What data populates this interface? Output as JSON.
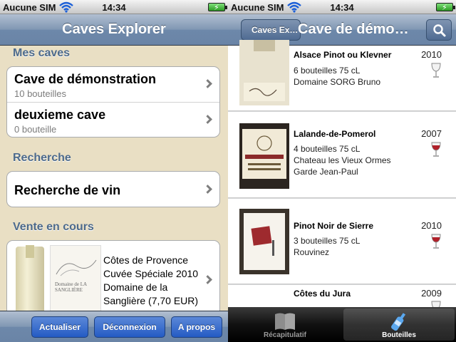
{
  "status_bar": {
    "carrier": "Aucune SIM",
    "time": "14:34"
  },
  "left": {
    "nav_title": "Caves Explorer",
    "sections": {
      "caves": "Mes caves",
      "search": "Recherche",
      "sales": "Vente en cours"
    },
    "caves": [
      {
        "name": "Cave de démonstration",
        "count": "10 bouteilles"
      },
      {
        "name": "deuxieme cave",
        "count": "0 bouteille"
      }
    ],
    "search_item": "Recherche de vin",
    "sale": {
      "line1": "Côtes de Provence",
      "line2": "Cuvée Spéciale 2010",
      "line3": "Domaine de la",
      "line4": "Sanglière (7,70 EUR)",
      "label_text": "Domaine de LA SANGLIÈRE"
    },
    "toolbar": {
      "refresh": "Actualiser",
      "logout": "Déconnexion",
      "about": "A propos"
    }
  },
  "right": {
    "back_label": "Caves Ex…",
    "nav_title": "Cave de démo…",
    "wines": [
      {
        "name": "Alsace Pinot ou Klevner",
        "year": "2010",
        "line1": "6 bouteilles 75 cL",
        "line2": "Domaine SORG Bruno",
        "line3": "",
        "glass": "white",
        "label_text": "Pinot Klevner"
      },
      {
        "name": "Lalande-de-Pomerol",
        "year": "2007",
        "line1": "4 bouteilles 75 cL",
        "line2": "Chateau les Vieux Ormes",
        "line3": "Garde Jean-Paul",
        "glass": "red",
        "label_text": "CHATEAU VIEUX ORMES"
      },
      {
        "name": "Pinot Noir de Sierre",
        "year": "2010",
        "line1": "3 bouteilles 75 cL",
        "line2": "Rouvinez",
        "line3": "",
        "glass": "red",
        "label_text": ""
      },
      {
        "name": "Côtes du Jura",
        "year": "2009",
        "line1": "",
        "line2": "",
        "line3": "",
        "glass": "white",
        "label_text": ""
      }
    ],
    "tabs": [
      {
        "label": "Récapitulatif",
        "icon": "book-icon"
      },
      {
        "label": "Bouteilles",
        "icon": "bottle-icon"
      }
    ],
    "colors": {
      "red_wine": "#b0202a",
      "white_wine": "#efefef"
    }
  }
}
